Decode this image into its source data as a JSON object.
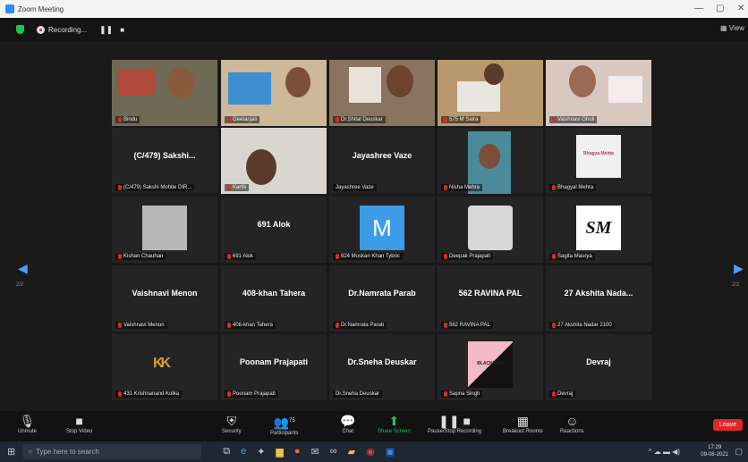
{
  "window": {
    "title": "Zoom Meeting",
    "controls": [
      "—",
      "▢",
      "✕"
    ]
  },
  "meeting_bar": {
    "recording_label": "Recording...",
    "view_label": "View"
  },
  "nav": {
    "left_page": "2/2",
    "right_page": "2/2"
  },
  "tiles": [
    {
      "label": "Bindu",
      "display": ""
    },
    {
      "label": "Geetanjali",
      "display": ""
    },
    {
      "label": "Dr.Shital Deuskar",
      "display": ""
    },
    {
      "label": "575 M Saira",
      "display": ""
    },
    {
      "label": "Vaishnavi Ghuli",
      "display": ""
    },
    {
      "label": "(C/479) Sakshi Mohite DIR...",
      "display": "(C/479) Sakshi..."
    },
    {
      "label": "Kartik",
      "display": ""
    },
    {
      "label": "Jayashree Vaze",
      "display": "Jayashree Vaze"
    },
    {
      "label": "Nisha Mehra",
      "display": ""
    },
    {
      "label": "Bhagyal Mehta",
      "display": ""
    },
    {
      "label": "Kishan Chauhan",
      "display": ""
    },
    {
      "label": "691 Alok",
      "display": "691 Alok"
    },
    {
      "label": "624 Muskan Khan Tyboc",
      "display": ""
    },
    {
      "label": "Deepak Prajapati",
      "display": ""
    },
    {
      "label": "Sagita Maurya",
      "display": ""
    },
    {
      "label": "Vaishnavi Menon",
      "display": "Vaishnavi Menon"
    },
    {
      "label": "408-khan Tahera",
      "display": "408-khan Tahera"
    },
    {
      "label": "Dr.Namrata Parab",
      "display": "Dr.Namrata Parab"
    },
    {
      "label": "562 RAVINA PAL",
      "display": "562 RAVINA PAL"
    },
    {
      "label": "27 Akshita Nadar 2100",
      "display": "27 Akshita Nada..."
    },
    {
      "label": "431 Krishnanand Kolka",
      "display": ""
    },
    {
      "label": "Poonam Prajapati",
      "display": "Poonam Prajapati"
    },
    {
      "label": "Dr.Sneha Deuskar",
      "display": "Dr.Sneha Deuskar"
    },
    {
      "label": "Sapna Singh",
      "display": ""
    },
    {
      "label": "Devraj",
      "display": "Devraj"
    }
  ],
  "avatars": {
    "m_letter": "M",
    "sm_letters": "SM",
    "kk_letters": "KK",
    "blackpink": "BLACKPINK",
    "flower_logo": "Bhagya Mehta"
  },
  "toolbar": {
    "unmute": "Unmute",
    "stop_video": "Stop Video",
    "security": "Security",
    "participants": "Participants",
    "participants_count": "75",
    "chat": "Chat",
    "share_screen": "Share Screen",
    "pause_recording": "Pause/Stop Recording",
    "breakout": "Breakout Rooms",
    "reactions": "Reactions",
    "leave": "Leave"
  },
  "taskbar": {
    "search_placeholder": "Type here to search",
    "time": "17:29",
    "date": "09-08-2021"
  },
  "colors": {
    "accent": "#2d8cff",
    "mic_red": "#e02828",
    "share_green": "#23c552"
  }
}
